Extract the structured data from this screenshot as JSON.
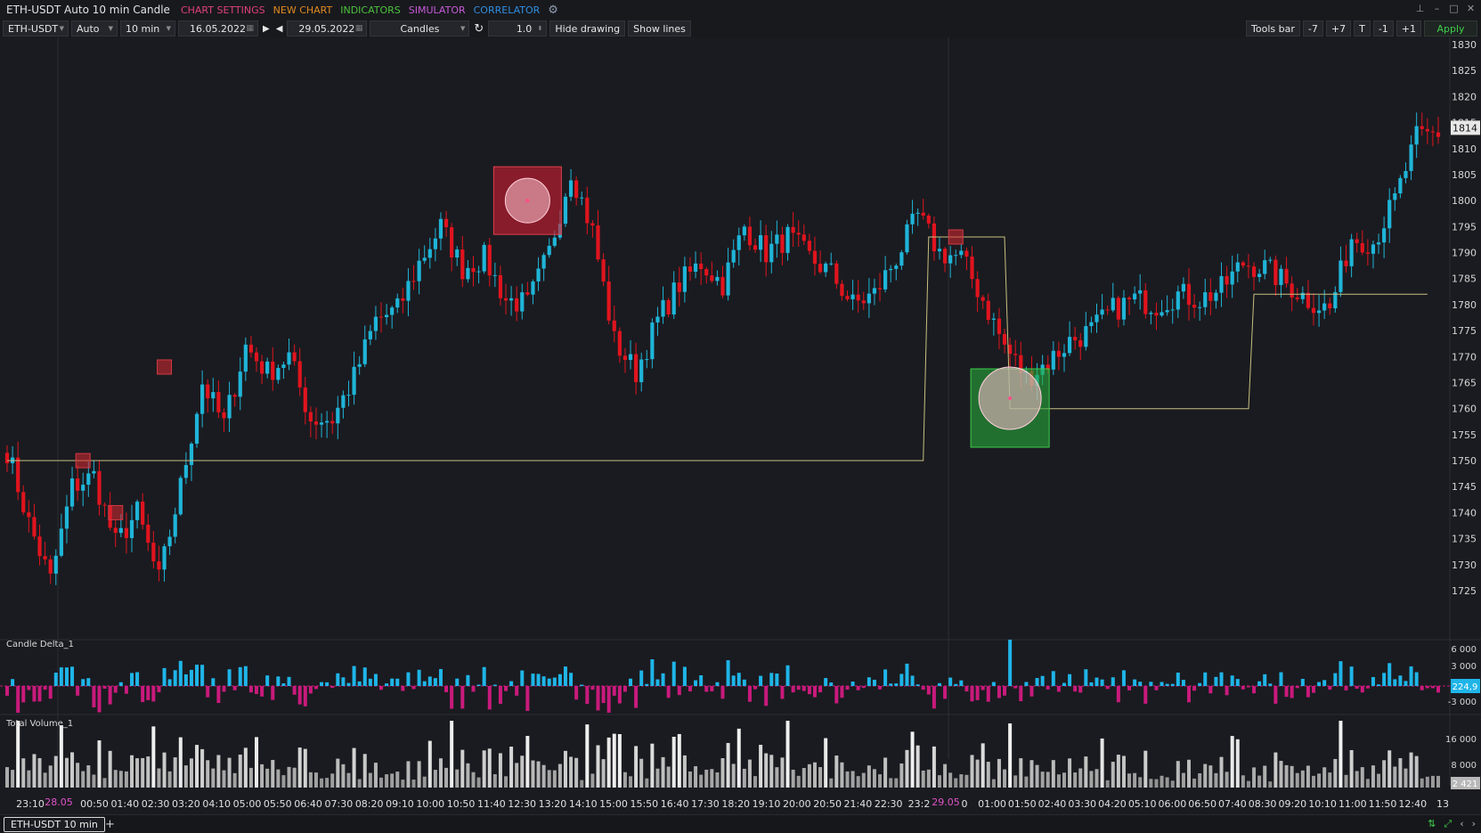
{
  "app": {
    "title": "ETH-USDT Auto 10 min Candle",
    "menu": [
      {
        "label": "CHART SETTINGS",
        "color": "#e0407a"
      },
      {
        "label": "NEW CHART",
        "color": "#e08a1e"
      },
      {
        "label": "INDICATORS",
        "color": "#4cc13b"
      },
      {
        "label": "SIMULATOR",
        "color": "#c65bd8"
      },
      {
        "label": "CORRELATOR",
        "color": "#2f8fe0"
      }
    ],
    "gear_icon": "gear-icon",
    "window_controls": [
      "pin-icon",
      "minimize-icon",
      "maximize-icon",
      "close-icon"
    ]
  },
  "toolbar": {
    "symbol": "ETH-USDT",
    "mode": "Auto",
    "timeframe": "10 min",
    "start_date": "16.05.2022",
    "end_date": "29.05.2022",
    "chart_type": "Candles",
    "scale_value": "1.0",
    "hide_drawing": "Hide drawing",
    "show_lines": "Show lines",
    "tools_bar": "Tools bar",
    "step_buttons": [
      "-7",
      "+7",
      "T",
      "-1",
      "+1"
    ],
    "apply": "Apply"
  },
  "price_axis": {
    "labels": [
      "1830",
      "1825",
      "1820",
      "1815",
      "1810",
      "1805",
      "1800",
      "1795",
      "1790",
      "1785",
      "1780",
      "1775",
      "1770",
      "1765",
      "1760",
      "1755",
      "1750",
      "1745",
      "1740",
      "1735",
      "1730",
      "1725"
    ],
    "current_price": "1814"
  },
  "indicators": [
    {
      "label": "Candle Delta_1",
      "axis_labels": [
        "6 000",
        "3 000",
        "-3 000"
      ],
      "current_value": "224,9"
    },
    {
      "label": "Total Volume_1",
      "axis_labels": [
        "16 000",
        "8 000"
      ],
      "current_value": "2 421"
    }
  ],
  "time_axis": {
    "labels": [
      "23:10",
      "00:50",
      "01:40",
      "02:30",
      "03:20",
      "04:10",
      "05:00",
      "05:50",
      "06:40",
      "07:30",
      "08:20",
      "09:10",
      "10:00",
      "10:50",
      "11:40",
      "12:30",
      "13:20",
      "14:10",
      "15:00",
      "15:50",
      "16:40",
      "17:30",
      "18:20",
      "19:10",
      "20:00",
      "20:50",
      "21:40",
      "22:30",
      "23:2",
      "0",
      "01:00",
      "01:50",
      "02:40",
      "03:30",
      "04:20",
      "05:10",
      "06:00",
      "06:50",
      "07:40",
      "08:30",
      "09:20",
      "10:10",
      "11:00",
      "11:50",
      "12:40",
      "13"
    ],
    "date_markers": [
      {
        "label": "28.05",
        "after_index": 0
      },
      {
        "label": "29.05",
        "after_index": 28
      }
    ]
  },
  "chart_data": {
    "type": "candlestick",
    "symbol": "ETH-USDT",
    "timeframe": "10 min",
    "price_range": [
      1723,
      1833
    ],
    "bull_color": "#1fb5d8",
    "bear_color": "#e0141e",
    "close_path": [
      [
        0,
        1752
      ],
      [
        4,
        1738
      ],
      [
        8,
        1727
      ],
      [
        12,
        1745
      ],
      [
        16,
        1747
      ],
      [
        20,
        1734
      ],
      [
        24,
        1740
      ],
      [
        28,
        1727
      ],
      [
        32,
        1745
      ],
      [
        36,
        1765
      ],
      [
        40,
        1757
      ],
      [
        44,
        1772
      ],
      [
        48,
        1767
      ],
      [
        52,
        1770
      ],
      [
        56,
        1758
      ],
      [
        60,
        1758
      ],
      [
        64,
        1766
      ],
      [
        68,
        1777
      ],
      [
        72,
        1779
      ],
      [
        76,
        1788
      ],
      [
        80,
        1795
      ],
      [
        84,
        1787
      ],
      [
        88,
        1789
      ],
      [
        92,
        1781
      ],
      [
        96,
        1780
      ],
      [
        100,
        1790
      ],
      [
        104,
        1806
      ],
      [
        108,
        1794
      ],
      [
        112,
        1773
      ],
      [
        116,
        1767
      ],
      [
        120,
        1777
      ],
      [
        124,
        1784
      ],
      [
        128,
        1788
      ],
      [
        132,
        1784
      ],
      [
        136,
        1795
      ],
      [
        140,
        1790
      ],
      [
        144,
        1793
      ],
      [
        148,
        1789
      ],
      [
        152,
        1786
      ],
      [
        156,
        1780
      ],
      [
        160,
        1782
      ],
      [
        164,
        1789
      ],
      [
        168,
        1797
      ],
      [
        172,
        1790
      ],
      [
        176,
        1789
      ],
      [
        180,
        1781
      ],
      [
        184,
        1772
      ],
      [
        188,
        1766
      ],
      [
        192,
        1769
      ],
      [
        196,
        1773
      ],
      [
        200,
        1775
      ],
      [
        204,
        1779
      ],
      [
        208,
        1781
      ],
      [
        212,
        1780
      ],
      [
        216,
        1782
      ],
      [
        220,
        1781
      ],
      [
        224,
        1783
      ],
      [
        228,
        1788
      ],
      [
        232,
        1787
      ],
      [
        236,
        1784
      ],
      [
        240,
        1781
      ],
      [
        244,
        1779
      ],
      [
        248,
        1793
      ],
      [
        252,
        1792
      ],
      [
        256,
        1800
      ],
      [
        260,
        1812
      ],
      [
        264,
        1813
      ]
    ],
    "signals": [
      {
        "type": "sell-square",
        "bar": 14,
        "price": 1750
      },
      {
        "type": "sell-square",
        "bar": 20,
        "price": 1740
      },
      {
        "type": "sell-square",
        "bar": 29,
        "price": 1768
      },
      {
        "type": "sell-box-large",
        "bar": 96,
        "price": 1800
      },
      {
        "type": "sell-square",
        "bar": 175,
        "price": 1793
      },
      {
        "type": "buy-box-large",
        "bar": 185,
        "price": 1762
      }
    ],
    "position_lines": [
      [
        [
          0,
          1750
        ],
        [
          169,
          1750
        ],
        [
          170,
          1793
        ],
        [
          184,
          1793
        ],
        [
          185,
          1760
        ],
        [
          229,
          1760
        ],
        [
          230,
          1782
        ],
        [
          262,
          1782
        ]
      ]
    ]
  }
}
